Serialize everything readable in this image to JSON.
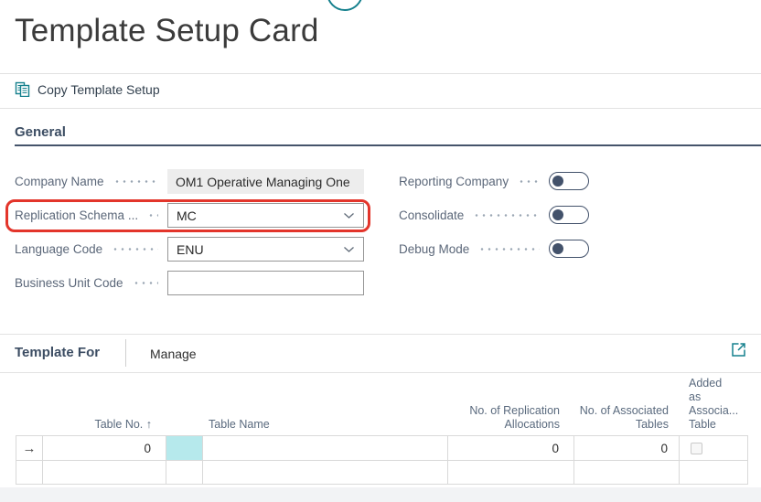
{
  "page": {
    "title": "Template Setup Card"
  },
  "toolbar": {
    "actions": [
      {
        "label": "Copy Template Setup",
        "icon": "copy-icon"
      }
    ]
  },
  "general": {
    "heading": "General",
    "fields": [
      {
        "label": "Company Name",
        "value": "OM1 Operative Managing One",
        "type": "readonly"
      },
      {
        "label": "Replication Schema ...",
        "value": "MC",
        "type": "combobox",
        "annotated": true
      },
      {
        "label": "Language Code",
        "value": "ENU",
        "type": "combobox"
      },
      {
        "label": "Business Unit Code",
        "value": "",
        "type": "text"
      }
    ],
    "toggles": [
      {
        "label": "Reporting Company",
        "state": "off"
      },
      {
        "label": "Consolidate",
        "state": "off"
      },
      {
        "label": "Debug Mode",
        "state": "off"
      }
    ]
  },
  "template_for": {
    "heading": "Template For",
    "menu_label": "Manage",
    "table": {
      "headers": [
        {
          "lines": [
            "Table No. ↑"
          ]
        },
        {
          "lines": [
            "Table Name"
          ]
        },
        {
          "lines": [
            "No. of Replication",
            "Allocations"
          ]
        },
        {
          "lines": [
            "No. of Associated",
            "Tables"
          ]
        },
        {
          "lines": [
            "Added",
            "as",
            "Associa...",
            "Table"
          ]
        }
      ],
      "rows": [
        {
          "table_no": "0",
          "table_name": "",
          "replication_allocations": "0",
          "associated_tables": "0",
          "added_as_table": false
        }
      ]
    }
  },
  "colors": {
    "accent_teal": "#15808d",
    "annotation_red": "#e3352b",
    "selected_cell_cyan": "#b6e9ec",
    "heading_slate": "#3c4d63"
  }
}
